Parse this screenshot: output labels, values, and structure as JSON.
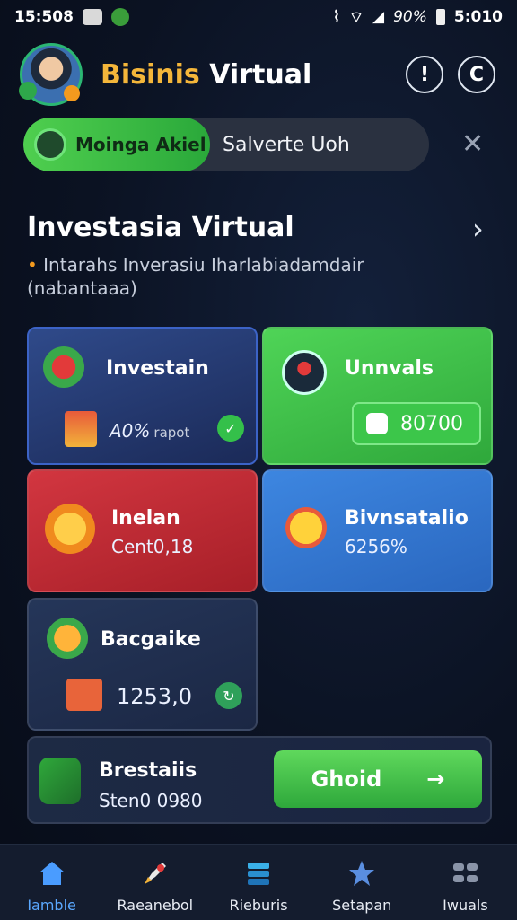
{
  "status_bar": {
    "time": "15:508",
    "battery": "90%",
    "clock": "5:010"
  },
  "header": {
    "title_part1": "Bisinis",
    "title_part2": " Virtual"
  },
  "market": {
    "label": "Moinga Akiel",
    "value": "Salverte Uoh"
  },
  "section": {
    "title": "Investasia Virtual",
    "subtitle": "Intarahs Inverasiu Iharlabiadamdair (nabantaaa)"
  },
  "cards": {
    "investain": {
      "title": "Investain",
      "value": "A0%",
      "unit": "rapot"
    },
    "unnvals": {
      "title": "Unnvals",
      "value": "80700"
    },
    "inelan": {
      "title": "Inelan",
      "value": "Cent0,18"
    },
    "bivnsatalio": {
      "title": "Bivnsatalio",
      "value": "6256%"
    },
    "bacgaike": {
      "title": "Bacgaike",
      "value": "1253,0"
    }
  },
  "bottom": {
    "title": "Brestaiis",
    "value": "Sten0 0980",
    "button_label": "Ghoid"
  },
  "nav": [
    {
      "label": "Iamble",
      "icon": "home-icon"
    },
    {
      "label": "Raeanebol",
      "icon": "rocket-icon"
    },
    {
      "label": "Rieburis",
      "icon": "stack-icon"
    },
    {
      "label": "Setapan",
      "icon": "star-icon"
    },
    {
      "label": "Iwuals",
      "icon": "grid-icon"
    }
  ],
  "colors": {
    "accent_green": "#3cc64a",
    "accent_orange": "#f4b63a",
    "nav_active": "#5aa8ff"
  }
}
